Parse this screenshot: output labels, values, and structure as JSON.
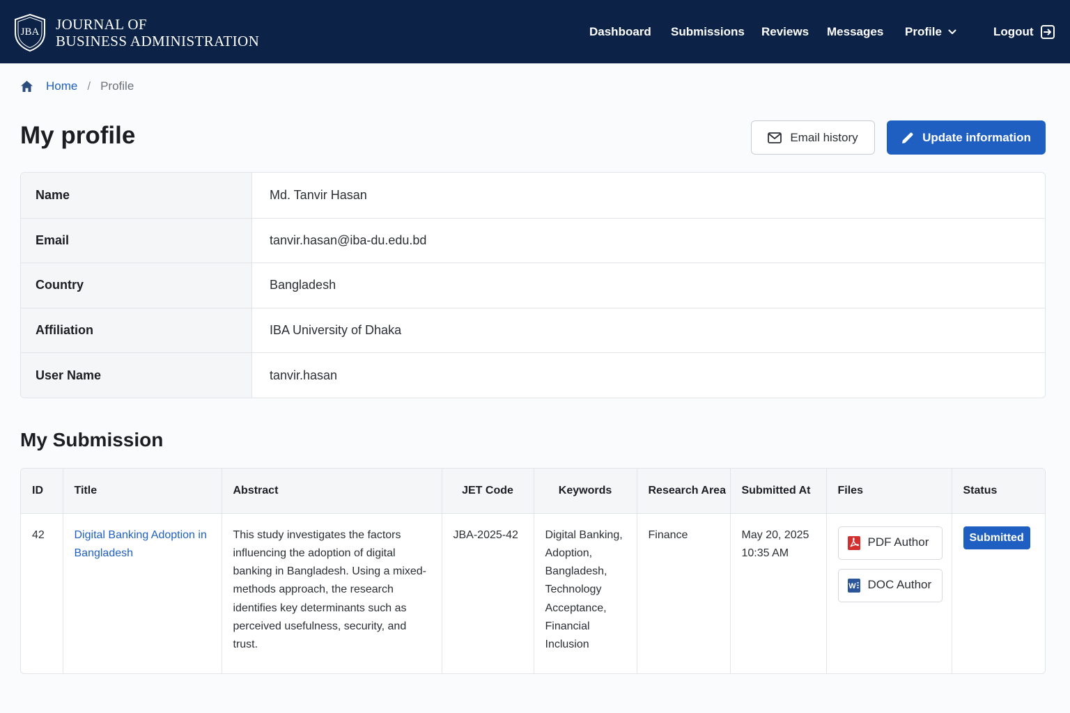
{
  "header": {
    "logo_text": "JBA",
    "brand_line1": "JOURNAL OF",
    "brand_line2": "BUSINESS ADMINISTRATION",
    "nav": {
      "dashboard": "Dashboard",
      "submissions": "Submissions",
      "reviews": "Reviews",
      "messages": "Messages",
      "profile": "Profile",
      "logout": "Logout"
    }
  },
  "breadcrumb": {
    "home": "Home",
    "separator": "/",
    "current": "Profile"
  },
  "page": {
    "title": "My profile",
    "email_history_label": "Email history",
    "update_label": "Update information"
  },
  "profile": {
    "rows": [
      {
        "label": "Name",
        "value": "Md. Tanvir Hasan"
      },
      {
        "label": "Email",
        "value": "tanvir.hasan@iba-du.edu.bd"
      },
      {
        "label": "Country",
        "value": "Bangladesh"
      },
      {
        "label": "Affiliation",
        "value": "IBA University of Dhaka"
      },
      {
        "label": "User Name",
        "value": "tanvir.hasan"
      }
    ]
  },
  "submissions": {
    "title": "My Submission",
    "columns": [
      "ID",
      "Title",
      "Abstract",
      "JET Code",
      "Keywords",
      "Research Area",
      "Submitted At",
      "Files",
      "Status"
    ],
    "rows": [
      {
        "id": "42",
        "title": "Digital Banking Adoption in Bangladesh",
        "abstract": "This study investigates the factors influencing the adoption of digital banking in Bangladesh. Using a mixed-methods approach, the research identifies key determinants such as perceived usefulness, security, and trust.",
        "jet_code": "JBA-2025-42",
        "keywords": "Digital Banking, Adoption, Bangladesh, Technology Acceptance, Financial Inclusion",
        "research_area": "Finance",
        "submitted_date": "May 20, 2025",
        "submitted_time": "10:35 AM",
        "files": [
          "PDF Author",
          "DOC Author"
        ],
        "status": "Submitted"
      }
    ]
  },
  "colors": {
    "navy": "#0c2347",
    "primary": "#1f5fc2",
    "pdf_red": "#d32f2f",
    "doc_blue": "#2b579a"
  }
}
